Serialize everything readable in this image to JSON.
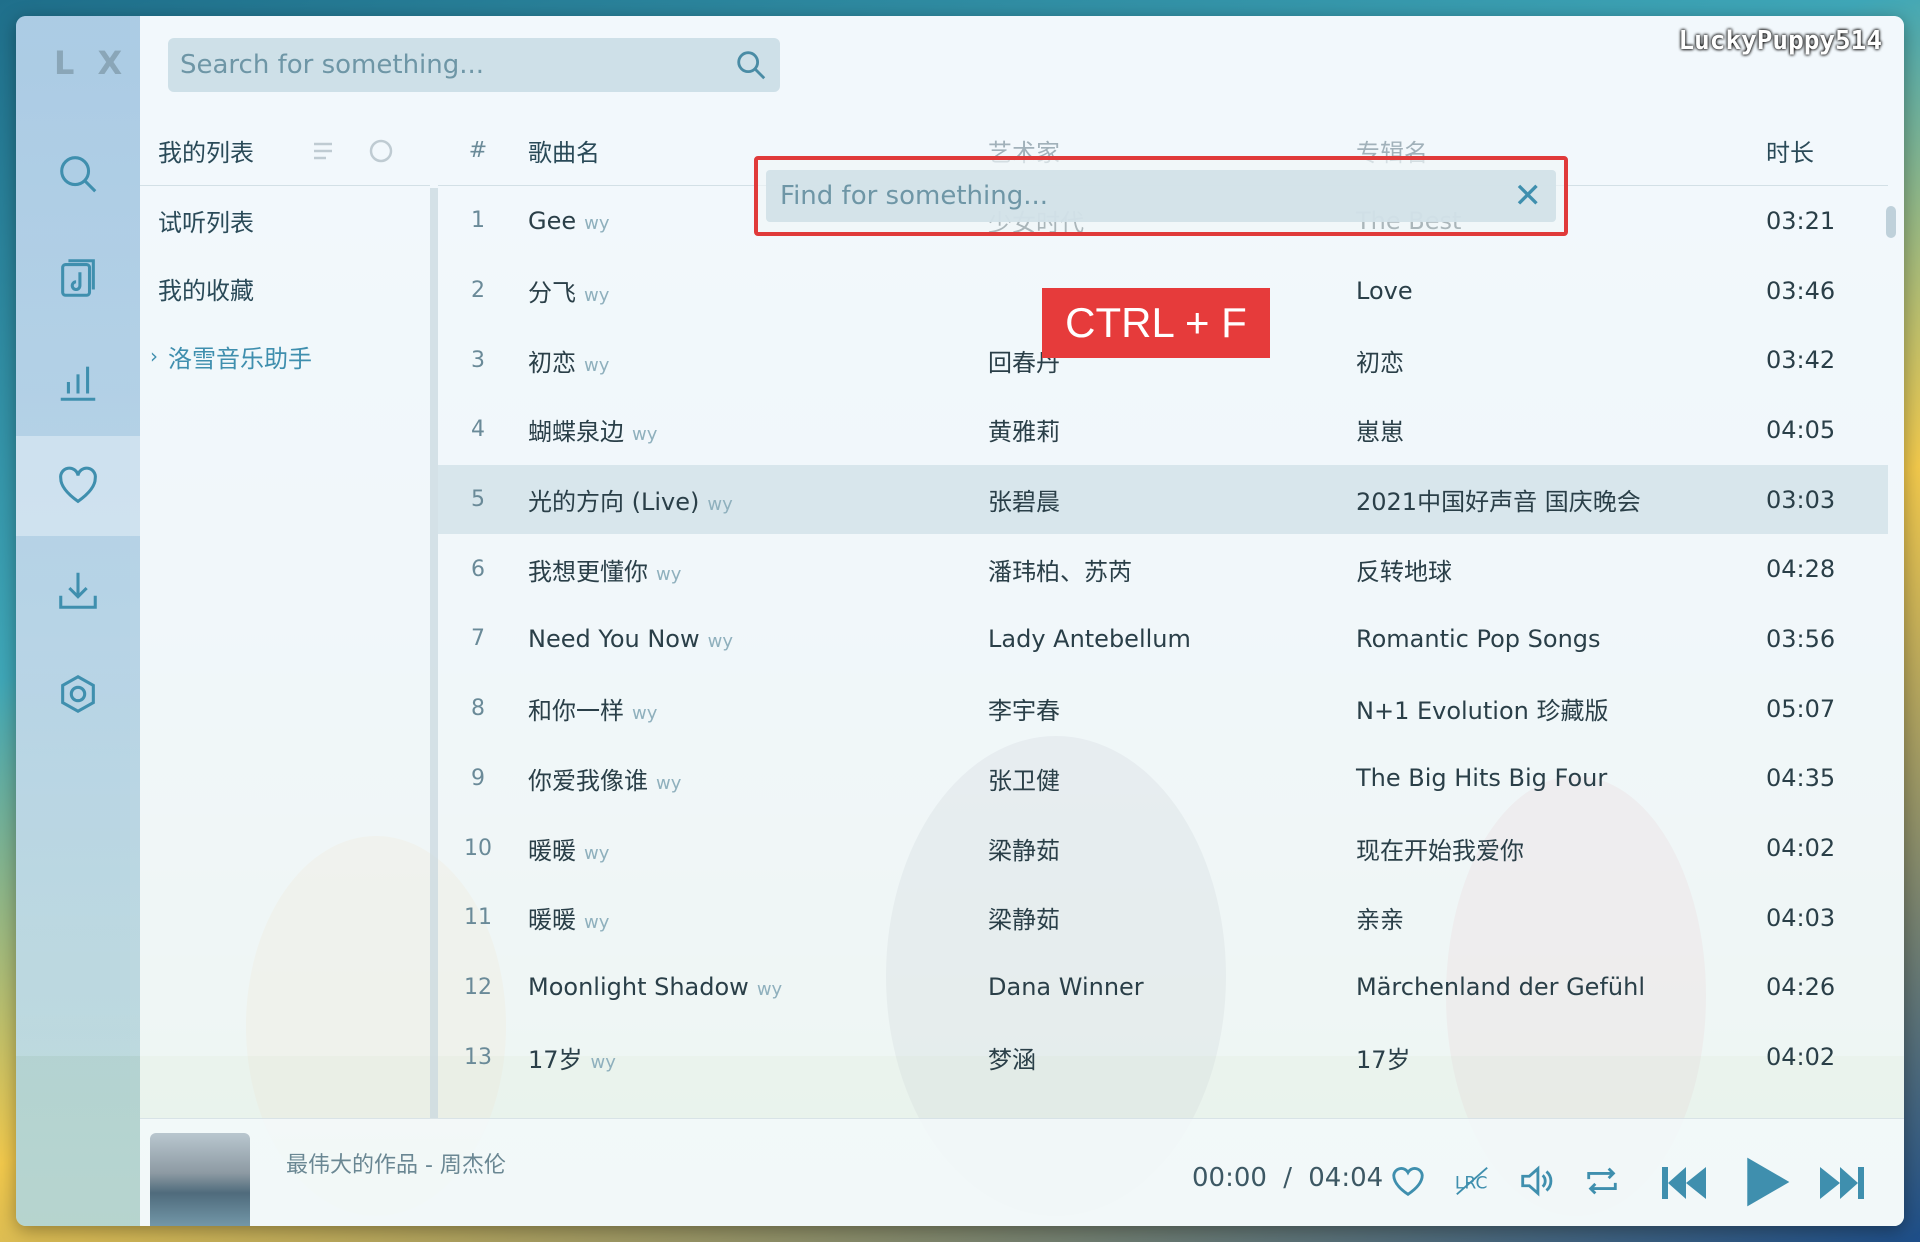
{
  "app": {
    "logo": "L X",
    "watermark": "LuckyPuppy514"
  },
  "search": {
    "placeholder": "Search for something..."
  },
  "find": {
    "placeholder": "Find for something..."
  },
  "shortcut_banner": "CTRL + F",
  "sidebar": {
    "header": "我的列表",
    "items": [
      {
        "label": "试听列表"
      },
      {
        "label": "我的收藏"
      },
      {
        "label": "洛雪音乐助手"
      }
    ]
  },
  "table": {
    "headers": {
      "num": "#",
      "name": "歌曲名",
      "artist": "艺术家",
      "album": "专辑名",
      "duration": "时长"
    },
    "source_tag": "wy",
    "rows": [
      {
        "n": "1",
        "name": "Gee",
        "artist": "少女时代",
        "album": "The Best",
        "dur": "03:21"
      },
      {
        "n": "2",
        "name": "分飞",
        "artist": "",
        "album": "Love",
        "dur": "03:46"
      },
      {
        "n": "3",
        "name": "初恋",
        "artist": "回春丹",
        "album": "初恋",
        "dur": "03:42"
      },
      {
        "n": "4",
        "name": "蝴蝶泉边",
        "artist": "黄雅莉",
        "album": "崽崽",
        "dur": "04:05"
      },
      {
        "n": "5",
        "name": "光的方向 (Live)",
        "artist": "张碧晨",
        "album": "2021中国好声音 国庆晚会",
        "dur": "03:03"
      },
      {
        "n": "6",
        "name": "我想更懂你",
        "artist": "潘玮柏、苏芮",
        "album": "反转地球",
        "dur": "04:28"
      },
      {
        "n": "7",
        "name": "Need You Now",
        "artist": "Lady Antebellum",
        "album": "Romantic Pop Songs",
        "dur": "03:56"
      },
      {
        "n": "8",
        "name": "和你一样",
        "artist": "李宇春",
        "album": "N+1 Evolution 珍藏版",
        "dur": "05:07"
      },
      {
        "n": "9",
        "name": "你爱我像谁",
        "artist": "张卫健",
        "album": "The Big Hits Big Four",
        "dur": "04:35"
      },
      {
        "n": "10",
        "name": "暖暖",
        "artist": "梁静茹",
        "album": "现在开始我爱你",
        "dur": "04:02"
      },
      {
        "n": "11",
        "name": "暖暖",
        "artist": "梁静茹",
        "album": "亲亲",
        "dur": "04:03"
      },
      {
        "n": "12",
        "name": "Moonlight Shadow",
        "artist": "Dana Winner",
        "album": "Märchenland der Gefühl",
        "dur": "04:26"
      },
      {
        "n": "13",
        "name": "17岁",
        "artist": "梦涵",
        "album": "17岁",
        "dur": "04:02"
      }
    ]
  },
  "player": {
    "now_playing": "最伟大的作品 - 周杰伦",
    "current_time": "00:00",
    "separator": "/",
    "total_time": "04:04"
  },
  "colors": {
    "accent": "#3f8fae",
    "highlight": "#e63b3b"
  },
  "icons": [
    "search-icon",
    "music-file-icon",
    "chart-icon",
    "heart-icon",
    "download-icon",
    "settings-icon",
    "lyrics-icon",
    "volume-icon",
    "repeat-icon",
    "prev-icon",
    "play-icon",
    "next-icon"
  ]
}
